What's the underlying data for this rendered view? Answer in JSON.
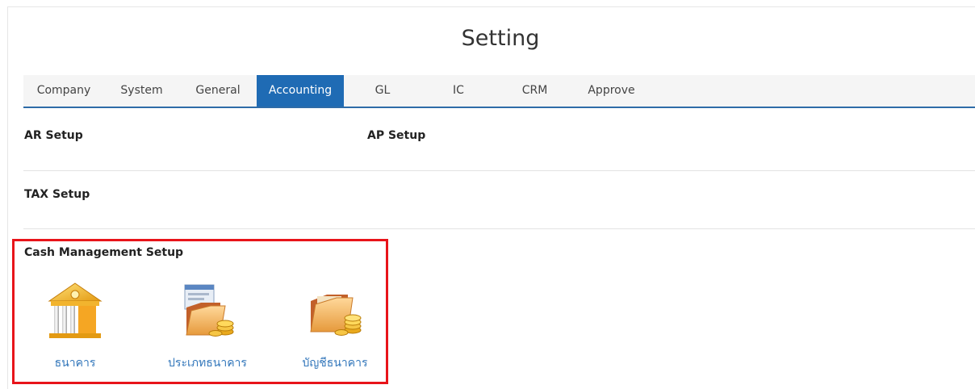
{
  "header": {
    "title": "Setting"
  },
  "tabs": [
    {
      "label": "Company"
    },
    {
      "label": "System"
    },
    {
      "label": "General"
    },
    {
      "label": "Accounting",
      "active": true
    },
    {
      "label": "GL"
    },
    {
      "label": "IC"
    },
    {
      "label": "CRM"
    },
    {
      "label": "Approve"
    }
  ],
  "sections": {
    "ar_setup": "AR Setup",
    "ap_setup": "AP Setup",
    "tax_setup": "TAX Setup",
    "cash_management_setup": "Cash Management Setup"
  },
  "cash_items": [
    {
      "label": "ธนาคาร",
      "icon": "bank-building-icon"
    },
    {
      "label": "ประเภทธนาคาร",
      "icon": "folder-coins-document-icon"
    },
    {
      "label": "บัญชีธนาคาร",
      "icon": "folder-coins-icon"
    }
  ],
  "colors": {
    "accent": "#1f6bb4",
    "highlight_border": "#e8141a",
    "link": "#3377bb"
  }
}
